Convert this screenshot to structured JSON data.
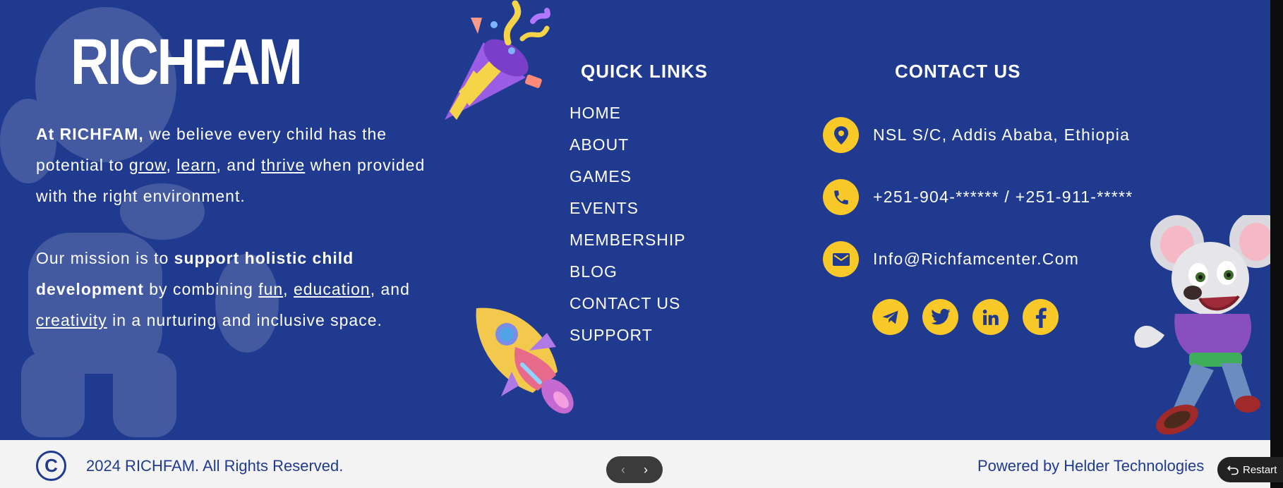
{
  "brand": {
    "logo_text": "RICHFAM"
  },
  "about": {
    "p1_bold": "At RICHFAM,",
    "p1_a": " we believe every child has the potential to ",
    "p1_grow": "grow",
    "p1_sep1": ", ",
    "p1_learn": "learn",
    "p1_sep2": ", and ",
    "p1_thrive": "thrive",
    "p1_b": " when provided with the right environment.",
    "p2_a": "Our mission is to ",
    "p2_bold": "support holistic child development",
    "p2_b": " by combining ",
    "p2_fun": "fun",
    "p2_sep1": ", ",
    "p2_education": "education",
    "p2_sep2": ", and ",
    "p2_creativity": "creativity",
    "p2_c": " in a nurturing and inclusive space."
  },
  "quick_links": {
    "title": "QUICK LINKS",
    "items": [
      "HOME",
      "ABOUT",
      "GAMES",
      "EVENTS",
      "MEMBERSHIP",
      "BLOG",
      "CONTACT US",
      "SUPPORT"
    ]
  },
  "contact": {
    "title": "CONTACT US",
    "address": "NSL S/C, Addis Ababa, Ethiopia",
    "phone": "+251-904-****** / +251-911-*****",
    "email": "Info@Richfamcenter.Com",
    "icons": [
      "location-pin-icon",
      "phone-icon",
      "mail-icon"
    ],
    "socials": [
      "telegram-icon",
      "twitter-icon",
      "linkedin-icon",
      "facebook-icon"
    ]
  },
  "footer": {
    "copyright_symbol": "C",
    "copyright": "2024 RICHFAM. All Rights Reserved.",
    "powered_by": "Powered by Helder Technologies"
  },
  "pager": {
    "prev": "‹",
    "next": "›"
  },
  "restart_label": "Restart",
  "colors": {
    "primary": "#1f3a8e",
    "accent": "#f9c92a",
    "footer_bg": "#f3f3f3"
  }
}
